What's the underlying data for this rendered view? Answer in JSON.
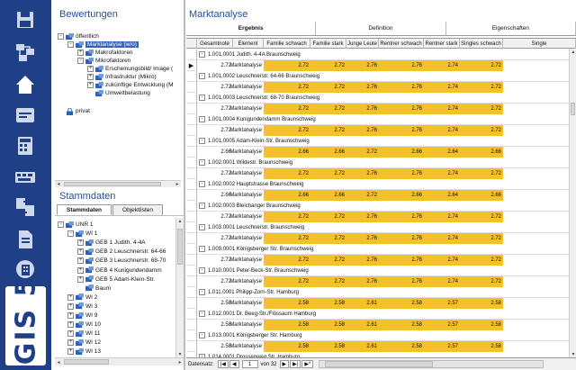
{
  "app": {
    "logo_text": "IGIS 5"
  },
  "nav": {
    "buttons": [
      {
        "icon": "save-icon",
        "color": "#cfd8ea"
      },
      {
        "icon": "network-icon",
        "color": "#cfd8ea"
      },
      {
        "icon": "home-icon",
        "color": "#ffffff"
      },
      {
        "icon": "card-icon",
        "color": "#cfd8ea"
      },
      {
        "icon": "calculator-icon",
        "color": "#cfd8ea"
      },
      {
        "icon": "keyboard-icon",
        "color": "#cfd8ea"
      },
      {
        "icon": "transfer-icon",
        "color": "#cfd8ea"
      },
      {
        "icon": "document-icon",
        "color": "#cfd8ea"
      },
      {
        "icon": "building-icon",
        "color": "#cfd8ea"
      }
    ]
  },
  "bewertungen": {
    "title": "Bewertungen",
    "tree": [
      {
        "label": "öffentlich",
        "indent": 0,
        "exp": "-",
        "selected": false
      },
      {
        "label": "Marktanalyse (w/o)",
        "indent": 1,
        "exp": "-",
        "selected": true
      },
      {
        "label": "Makrofaktoren",
        "indent": 2,
        "exp": "+",
        "selected": false
      },
      {
        "label": "Mikrofaktoren",
        "indent": 2,
        "exp": "-",
        "selected": false
      },
      {
        "label": "Erscheinungsbild/ Image (",
        "indent": 3,
        "exp": "+",
        "selected": false
      },
      {
        "label": "Infrastruktur (Mikro)",
        "indent": 3,
        "exp": "+",
        "selected": false
      },
      {
        "label": "zukünftige Entwicklung (M",
        "indent": 3,
        "exp": "+",
        "selected": false
      },
      {
        "label": "Umweltbelastung",
        "indent": 3,
        "exp": "",
        "selected": false
      },
      {
        "label": "privat",
        "indent": 0,
        "exp": "",
        "selected": false
      }
    ]
  },
  "stammdaten": {
    "title": "Stammdaten",
    "tabs": [
      "Stammdaten",
      "Objektlisten"
    ],
    "tree": [
      {
        "label": "UNR 1",
        "indent": 0,
        "exp": "-"
      },
      {
        "label": "WI 1",
        "indent": 1,
        "exp": "-"
      },
      {
        "label": "GEB 1 Judith. 4-4A",
        "indent": 2,
        "exp": "+"
      },
      {
        "label": "GEB 2 Leuschnerstr. 64-66",
        "indent": 2,
        "exp": "+"
      },
      {
        "label": "GEB 3 Leuschnerstr. 68-70",
        "indent": 2,
        "exp": "+"
      },
      {
        "label": "GEB 4 Kunigundendamm",
        "indent": 2,
        "exp": "+"
      },
      {
        "label": "GEB 5 Adam-Klein-Str.",
        "indent": 2,
        "exp": "+"
      },
      {
        "label": "Baum",
        "indent": 2,
        "exp": ""
      },
      {
        "label": "WI 2",
        "indent": 1,
        "exp": "+"
      },
      {
        "label": "WI 3",
        "indent": 1,
        "exp": "+"
      },
      {
        "label": "WI 9",
        "indent": 1,
        "exp": "+"
      },
      {
        "label": "WI 10",
        "indent": 1,
        "exp": "+"
      },
      {
        "label": "WI 11",
        "indent": 1,
        "exp": "+"
      },
      {
        "label": "WI 12",
        "indent": 1,
        "exp": "+"
      },
      {
        "label": "WI 13",
        "indent": 1,
        "exp": "+"
      }
    ]
  },
  "marktanalyse": {
    "title": "Marktanalyse",
    "tabs": [
      "Ergebnis",
      "Definition",
      "Eigenschaften"
    ],
    "columns": [
      "Gesamtnote",
      "Element",
      "Familie schwach",
      "Familie stark",
      "Junge Leute",
      "Rentner schwach",
      "Rentner stark",
      "Singles schwach",
      "Single"
    ],
    "rows": [
      {
        "group": "1.001.0001 Judith. 4-4A Braunschweig",
        "current": true,
        "values": [
          "2.72",
          "Marktanalyse",
          "2.72",
          "2.72",
          "2.76",
          "2.76",
          "2.74",
          "2.72"
        ]
      },
      {
        "group": "1.001.0002 Leuschnerstr. 64-66 Braunschweig",
        "current": false,
        "values": [
          "2.72",
          "Marktanalyse",
          "2.72",
          "2.72",
          "2.76",
          "2.76",
          "2.74",
          "2.72"
        ]
      },
      {
        "group": "1.001.0003 Leuschnerstr. 68-70 Braunschweig",
        "current": false,
        "values": [
          "2.72",
          "Marktanalyse",
          "2.72",
          "2.72",
          "2.76",
          "2.76",
          "2.74",
          "2.72"
        ]
      },
      {
        "group": "1.001.0004 Kunigundendamm Braunschweig",
        "current": false,
        "values": [
          "2.72",
          "Marktanalyse",
          "2.72",
          "2.72",
          "2.76",
          "2.76",
          "2.74",
          "2.72"
        ]
      },
      {
        "group": "1.001.0005 Adam-Klein-Str. Braunschweig",
        "current": false,
        "values": [
          "2.66",
          "Marktanalyse",
          "2.66",
          "2.66",
          "2.72",
          "2.66",
          "2.64",
          "2.66"
        ]
      },
      {
        "group": "1.002.0001 Wildestr. Braunschweig",
        "current": false,
        "values": [
          "2.72",
          "Marktanalyse",
          "2.72",
          "2.72",
          "2.76",
          "2.76",
          "2.74",
          "2.72"
        ]
      },
      {
        "group": "1.002.0002 Hauptstrasse Braunschweig",
        "current": false,
        "values": [
          "2.66",
          "Marktanalyse",
          "2.66",
          "2.66",
          "2.72",
          "2.66",
          "2.64",
          "2.66"
        ]
      },
      {
        "group": "1.002.0003 Bleichanger Braunschweig",
        "current": false,
        "values": [
          "2.72",
          "Marktanalyse",
          "2.72",
          "2.72",
          "2.76",
          "2.76",
          "2.74",
          "2.72"
        ]
      },
      {
        "group": "1.003.0001 Leuschnerstr. Braunschweig",
        "current": false,
        "values": [
          "2.72",
          "Marktanalyse",
          "2.72",
          "2.72",
          "2.76",
          "2.76",
          "2.74",
          "2.72"
        ]
      },
      {
        "group": "1.009.0001 Königsberger Str. Braunschweig",
        "current": false,
        "values": [
          "2.72",
          "Marktanalyse",
          "2.72",
          "2.72",
          "2.76",
          "2.76",
          "2.74",
          "2.72"
        ]
      },
      {
        "group": "1.010.0001 Peter-Beck-Str. Braunschweig",
        "current": false,
        "values": [
          "2.72",
          "Marktanalyse",
          "2.72",
          "2.72",
          "2.76",
          "2.76",
          "2.74",
          "2.72"
        ]
      },
      {
        "group": "1.011.0001 Philipp-Zorn-Str. Hamburg",
        "current": false,
        "values": [
          "2.58",
          "Marktanalyse",
          "2.58",
          "2.58",
          "2.61",
          "2.58",
          "2.57",
          "2.58"
        ]
      },
      {
        "group": "1.012.0001 Dr. Beeg-Str./Flössaum Hamburg",
        "current": false,
        "values": [
          "2.58",
          "Marktanalyse",
          "2.58",
          "2.58",
          "2.61",
          "2.58",
          "2.57",
          "2.58"
        ]
      },
      {
        "group": "1.013.0001 Königsberger Str. Hamburg",
        "current": false,
        "values": [
          "2.58",
          "Marktanalyse",
          "2.58",
          "2.58",
          "2.61",
          "2.58",
          "2.57",
          "2.58"
        ]
      },
      {
        "group": "1.014.0001 Drossenweg Str. Hamburg",
        "current": false,
        "values": []
      }
    ],
    "footer": {
      "label": "Datensatz:",
      "current": "1",
      "of_label": "von 32"
    },
    "highlight_color": "#f5c02c"
  }
}
